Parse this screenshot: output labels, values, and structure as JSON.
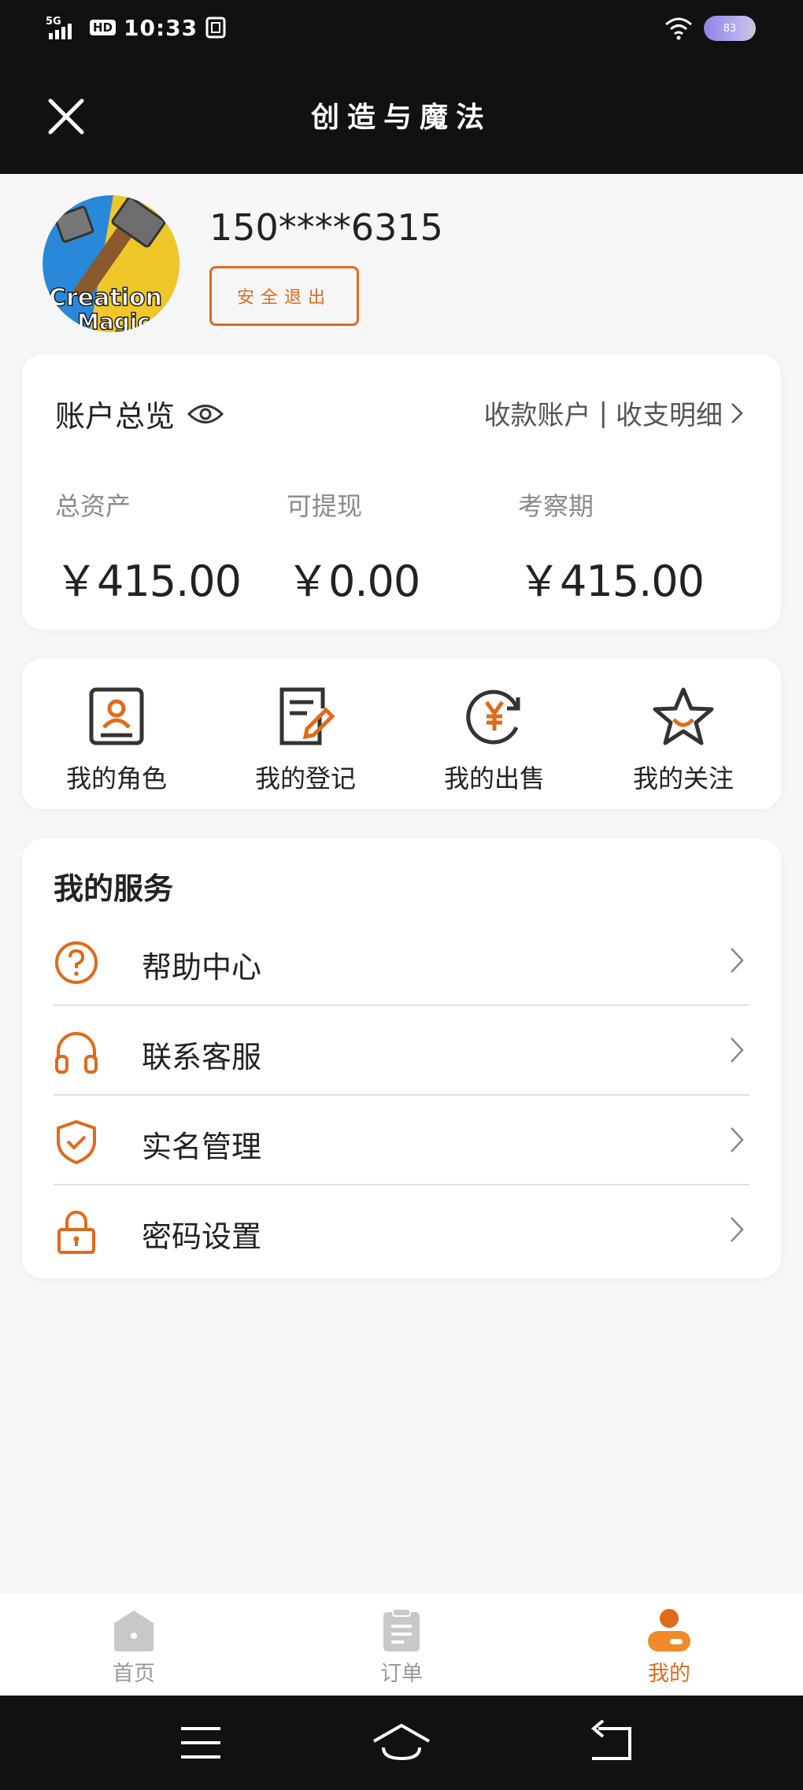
{
  "status_bar": {
    "network": "5G",
    "hd": "HD",
    "time": "10:33",
    "battery": "83"
  },
  "header": {
    "title": "创造与魔法"
  },
  "profile": {
    "phone": "150****6315",
    "logout_label": "安全退出",
    "avatar_text": "Creation Magic"
  },
  "account": {
    "title": "账户总览",
    "links": {
      "receive_account": "收款账户",
      "separator": "|",
      "statement": "收支明细"
    },
    "stats": [
      {
        "label": "总资产",
        "value": "￥415.00"
      },
      {
        "label": "可提现",
        "value": "￥0.00"
      },
      {
        "label": "考察期",
        "value": "￥415.00"
      }
    ]
  },
  "quick_actions": [
    {
      "label": "我的角色",
      "icon": "role-card-icon"
    },
    {
      "label": "我的登记",
      "icon": "edit-document-icon"
    },
    {
      "label": "我的出售",
      "icon": "yen-sell-icon"
    },
    {
      "label": "我的关注",
      "icon": "star-icon"
    }
  ],
  "services": {
    "title": "我的服务",
    "items": [
      {
        "label": "帮助中心",
        "icon": "help-icon"
      },
      {
        "label": "联系客服",
        "icon": "headset-icon"
      },
      {
        "label": "实名管理",
        "icon": "shield-check-icon"
      },
      {
        "label": "密码设置",
        "icon": "lock-icon"
      }
    ]
  },
  "tabbar": [
    {
      "label": "首页",
      "icon": "home-icon",
      "active": false
    },
    {
      "label": "订单",
      "icon": "order-icon",
      "active": false
    },
    {
      "label": "我的",
      "icon": "profile-icon",
      "active": true
    }
  ],
  "colors": {
    "accent": "#e06a1c",
    "dark_bar": "#111111",
    "background": "#f6f6f6"
  }
}
